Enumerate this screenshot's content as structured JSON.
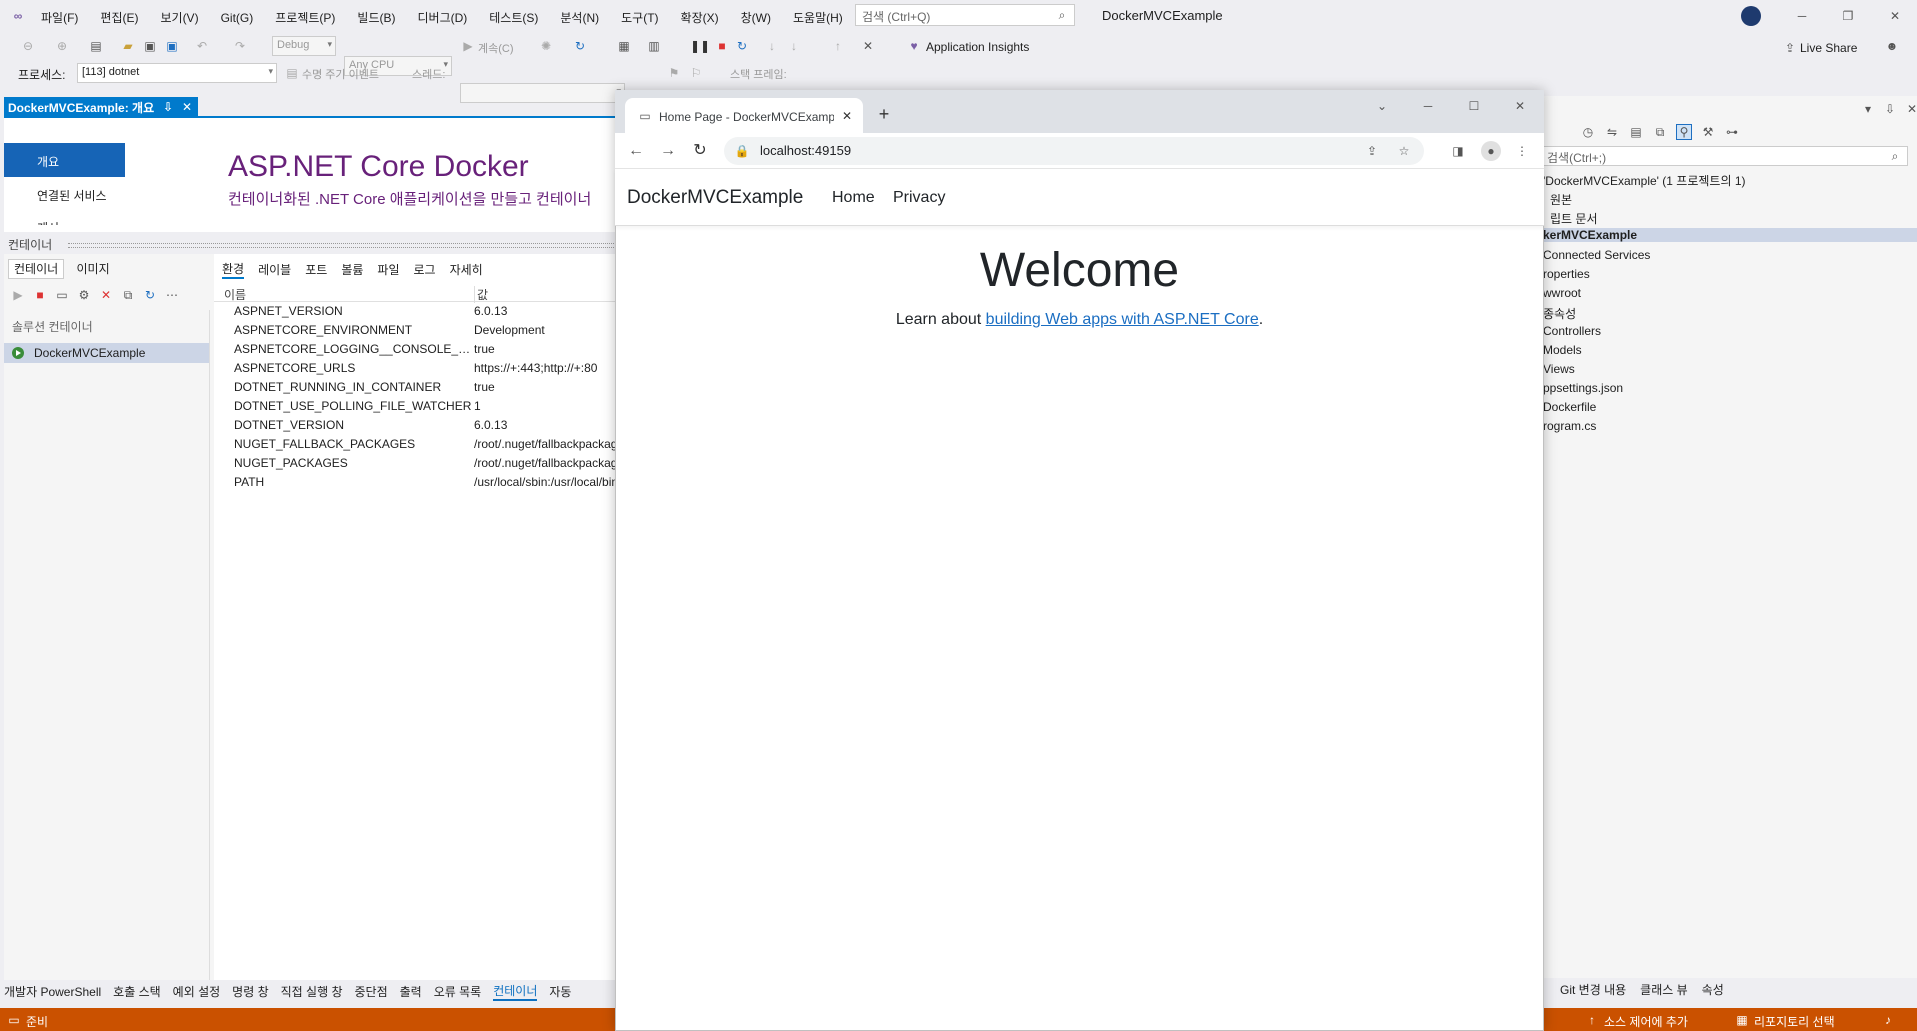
{
  "menu": {
    "items": [
      "파일(F)",
      "편집(E)",
      "보기(V)",
      "Git(G)",
      "프로젝트(P)",
      "빌드(B)",
      "디버그(D)",
      "테스트(S)",
      "분석(N)",
      "도구(T)",
      "확장(X)",
      "창(W)",
      "도움말(H)"
    ],
    "search_placeholder": "검색 (Ctrl+Q)",
    "solution_title": "DockerMVCExample"
  },
  "toolbar": {
    "config": "Debug",
    "platform": "Any CPU",
    "continue_label": "계속(C)",
    "app_insights": "Application Insights",
    "live_share": "Live Share",
    "process_label": "프로세스:",
    "process_value": "[113] dotnet",
    "lifecycle_label": "수명 주기 이벤트",
    "thread_label": "스레드:",
    "stackframe_label": "스택 프레임:"
  },
  "doc": {
    "tab_title": "DockerMVCExample: 개요",
    "nav": [
      "개요",
      "연결된 서비스",
      "게시"
    ],
    "heading": "ASP.NET Core Docker",
    "subheading": "컨테이너화된 .NET Core 애플리케이션을 만들고 컨테이너"
  },
  "containers": {
    "panel_title": "컨테이너",
    "tabs": [
      "컨테이너",
      "이미지"
    ],
    "group": "솔루션 컨테이너",
    "item": "DockerMVCExample",
    "env_tabs": [
      "환경",
      "레이블",
      "포트",
      "볼륨",
      "파일",
      "로그",
      "자세히"
    ],
    "col_name": "이름",
    "col_value": "값",
    "env": [
      {
        "k": "ASPNET_VERSION",
        "v": "6.0.13"
      },
      {
        "k": "ASPNETCORE_ENVIRONMENT",
        "v": "Development"
      },
      {
        "k": "ASPNETCORE_LOGGING__CONSOLE__DIS...",
        "v": "true"
      },
      {
        "k": "ASPNETCORE_URLS",
        "v": "https://+:443;http://+:80"
      },
      {
        "k": "DOTNET_RUNNING_IN_CONTAINER",
        "v": "true"
      },
      {
        "k": "DOTNET_USE_POLLING_FILE_WATCHER",
        "v": "1"
      },
      {
        "k": "DOTNET_VERSION",
        "v": "6.0.13"
      },
      {
        "k": "NUGET_FALLBACK_PACKAGES",
        "v": "/root/.nuget/fallbackpackages"
      },
      {
        "k": "NUGET_PACKAGES",
        "v": "/root/.nuget/fallbackpackages"
      },
      {
        "k": "PATH",
        "v": "/usr/local/sbin:/usr/local/bin"
      }
    ]
  },
  "bottom_tabs": [
    "개발자 PowerShell",
    "호출 스택",
    "예외 설정",
    "명령 창",
    "직접 실행 창",
    "중단점",
    "출력",
    "오류 목록",
    "컨테이너",
    "자동"
  ],
  "right_bottom_tabs": [
    "Git 변경 내용",
    "클래스 뷰",
    "속성"
  ],
  "status": {
    "ready": "준비",
    "add_source": "소스 제어에 추가",
    "select_repo": "리포지토리 선택"
  },
  "solution": {
    "search": "검색(Ctrl+;)",
    "items": [
      "'DockerMVCExample' (1 프로젝트의 1)",
      "원본",
      "립트 문서",
      "kerMVCExample",
      "Connected Services",
      "roperties",
      "wwroot",
      "종속성",
      "Controllers",
      "Models",
      "Views",
      "ppsettings.json",
      "Dockerfile",
      "rogram.cs"
    ]
  },
  "browser": {
    "tab_title": "Home Page - DockerMVCExample",
    "url": "localhost:49159",
    "brand": "DockerMVCExample",
    "nav_home": "Home",
    "nav_privacy": "Privacy",
    "welcome": "Welcome",
    "learn_prefix": "Learn about ",
    "learn_link": "building Web apps with ASP.NET Core",
    "learn_suffix": "."
  },
  "colors": {
    "accent": "#007acc",
    "status": "#ca5100",
    "link": "#1b6ec2"
  }
}
